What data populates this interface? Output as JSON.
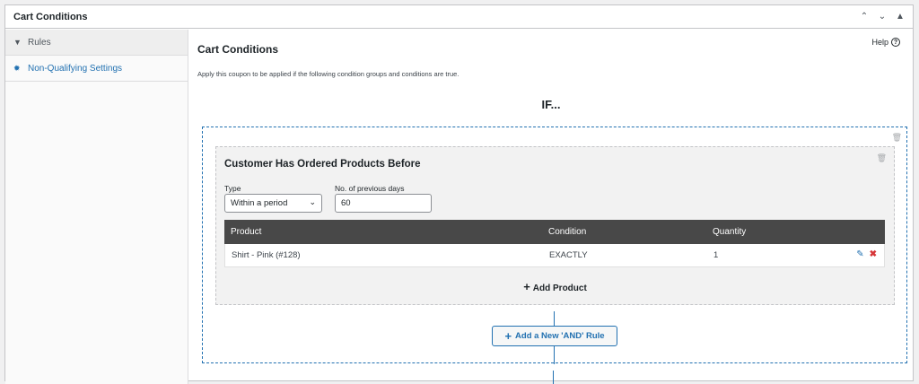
{
  "panel": {
    "title": "Cart Conditions",
    "ctrls": {
      "up": "⌃",
      "down": "⌄",
      "collapse": "▲"
    }
  },
  "sidebar": {
    "items": [
      {
        "label": "Rules",
        "icon": "filter-icon"
      },
      {
        "label": "Non-Qualifying Settings",
        "icon": "gear-icon"
      }
    ]
  },
  "main": {
    "title": "Cart Conditions",
    "help_label": "Help",
    "description": "Apply this coupon to be applied if the following condition groups and conditions are true.",
    "if_label": "IF..."
  },
  "condition": {
    "title": "Customer Has Ordered Products Before",
    "type_label": "Type",
    "type_value": "Within a period",
    "days_label": "No. of previous days",
    "days_value": "60",
    "table": {
      "headers": [
        "Product",
        "Condition",
        "Quantity"
      ],
      "rows": [
        {
          "product": "Shirt - Pink (#128)",
          "condition": "EXACTLY",
          "quantity": "1"
        }
      ]
    },
    "add_product_label": "Add Product"
  },
  "and_button_label": "Add a New 'AND' Rule",
  "colors": {
    "accent": "#2271b1",
    "danger": "#d63638",
    "table_header": "#484848"
  }
}
